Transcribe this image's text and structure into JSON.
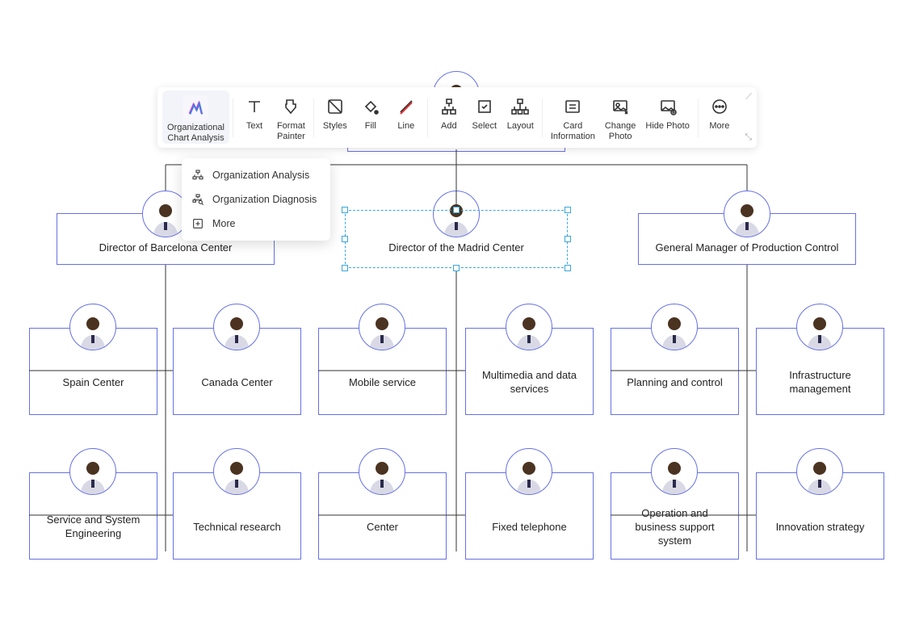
{
  "toolbar": {
    "items": [
      {
        "id": "org-analysis",
        "label": "Organizational\nChart Analysis",
        "icon": "org-logo"
      },
      {
        "id": "text",
        "label": "Text",
        "icon": "text"
      },
      {
        "id": "format-painter",
        "label": "Format\nPainter",
        "icon": "format-painter"
      },
      {
        "id": "styles",
        "label": "Styles",
        "icon": "styles"
      },
      {
        "id": "fill",
        "label": "Fill",
        "icon": "fill"
      },
      {
        "id": "line",
        "label": "Line",
        "icon": "line"
      },
      {
        "id": "add",
        "label": "Add",
        "icon": "add"
      },
      {
        "id": "select",
        "label": "Select",
        "icon": "select"
      },
      {
        "id": "layout",
        "label": "Layout",
        "icon": "layout"
      },
      {
        "id": "card-info",
        "label": "Card\nInformation",
        "icon": "card-info"
      },
      {
        "id": "change-photo",
        "label": "Change\nPhoto",
        "icon": "change-photo"
      },
      {
        "id": "hide-photo",
        "label": "Hide Photo",
        "icon": "hide-photo"
      },
      {
        "id": "more",
        "label": "More",
        "icon": "more"
      }
    ]
  },
  "dropdown": {
    "items": [
      {
        "id": "org-analysis-item",
        "label": "Organization Analysis",
        "icon": "hierarchy"
      },
      {
        "id": "org-diagnosis-item",
        "label": "Organization Diagnosis",
        "icon": "hierarchy-search"
      },
      {
        "id": "more-item",
        "label": "More",
        "icon": "plus-box"
      }
    ]
  },
  "chart_data": {
    "type": "org-chart",
    "nodes": [
      {
        "id": "root",
        "label": "",
        "parent": null
      },
      {
        "id": "barcelona",
        "label": "Director of Barcelona Center",
        "parent": "root"
      },
      {
        "id": "madrid",
        "label": "Director of the Madrid Center",
        "parent": "root",
        "selected": true
      },
      {
        "id": "prodctrl",
        "label": "General Manager of Production Control",
        "parent": "root"
      },
      {
        "id": "spain",
        "label": "Spain Center",
        "parent": "barcelona"
      },
      {
        "id": "canada",
        "label": "Canada Center",
        "parent": "barcelona"
      },
      {
        "id": "svcsys",
        "label": "Service and System Engineering",
        "parent": "barcelona"
      },
      {
        "id": "techres",
        "label": "Technical research",
        "parent": "barcelona"
      },
      {
        "id": "mobile",
        "label": "Mobile service",
        "parent": "madrid"
      },
      {
        "id": "multimedia",
        "label": "Multimedia and data services",
        "parent": "madrid"
      },
      {
        "id": "center",
        "label": "Center",
        "parent": "madrid"
      },
      {
        "id": "fixedtel",
        "label": "Fixed telephone",
        "parent": "madrid"
      },
      {
        "id": "planning",
        "label": "Planning and control",
        "parent": "prodctrl"
      },
      {
        "id": "infra",
        "label": "Infrastructure management",
        "parent": "prodctrl"
      },
      {
        "id": "ops",
        "label": "Operation and business support system",
        "parent": "prodctrl"
      },
      {
        "id": "innov",
        "label": "Innovation strategy",
        "parent": "prodctrl"
      }
    ],
    "node_style": {
      "border_color": "#6671e5",
      "avatar": true
    },
    "selected_node": "madrid"
  }
}
